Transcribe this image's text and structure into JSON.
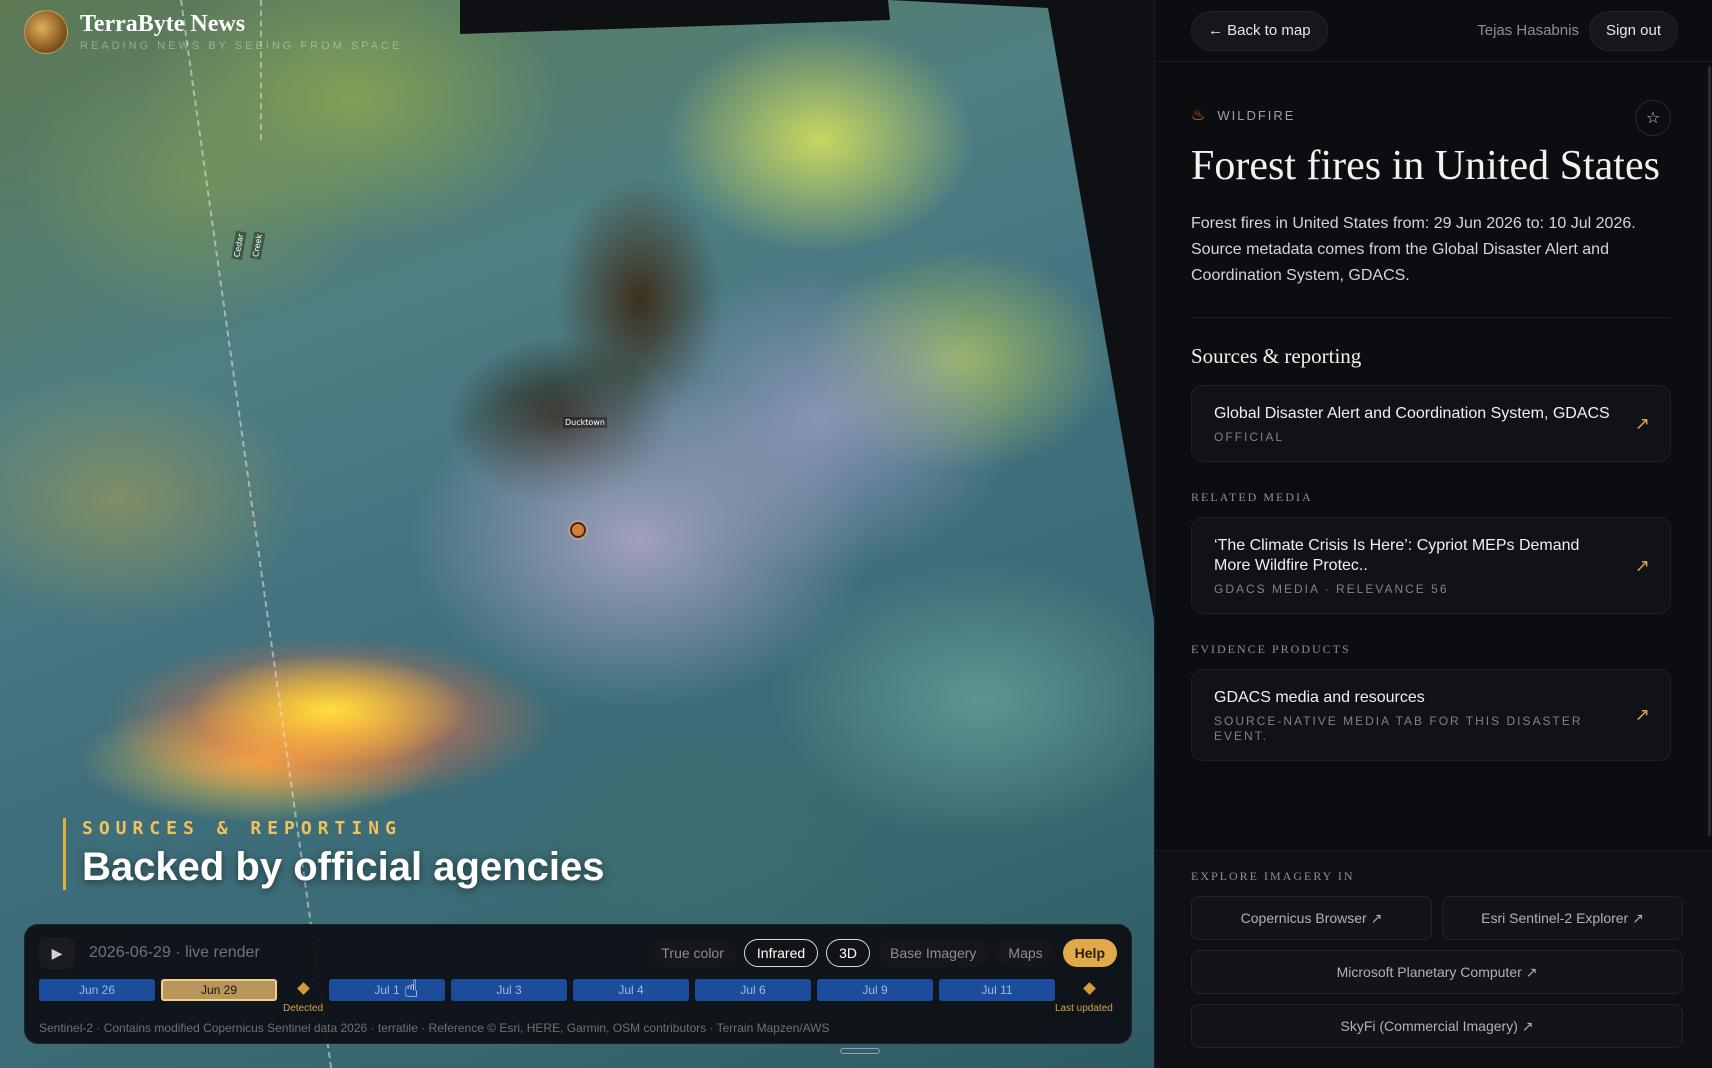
{
  "brand": {
    "name": "TerraByte News",
    "tagline": "READING NEWS BY SEEING FROM SPACE"
  },
  "map": {
    "labels": [
      "Cedar",
      "Creek",
      "Ducktown"
    ],
    "story": {
      "kicker": "SOURCES & REPORTING",
      "headline": "Backed by official agencies"
    }
  },
  "controls": {
    "play_icon": "▶",
    "date_readout": "2026-06-29 · live render",
    "toggles": [
      {
        "label": "True color",
        "active": false
      },
      {
        "label": "Infrared",
        "active": true
      },
      {
        "label": "3D",
        "active": true
      },
      {
        "label": "Base Imagery",
        "active": false
      },
      {
        "label": "Maps",
        "active": false
      },
      {
        "label": "Help",
        "active": false
      }
    ],
    "timeline": {
      "dates": [
        "Jun 26",
        "Jun 29",
        "Jul 1",
        "Jul 3",
        "Jul 4",
        "Jul 6",
        "Jul 9",
        "Jul 11"
      ],
      "selected": "Jun 29",
      "detected_label": "Detected",
      "last_updated_label": "Last updated"
    },
    "attribution": "Sentinel-2 · Contains modified Copernicus Sentinel data 2026 · terratile · Reference © Esri, HERE, Garmin, OSM contributors · Terrain Mapzen/AWS"
  },
  "sidebar": {
    "back_label": "← Back to map",
    "user_name": "Tejas Hasabnis",
    "signout_label": "Sign out",
    "category": "WILDFIRE",
    "title": "Forest fires in United States",
    "description": "Forest fires in United States from: 29 Jun 2026 to: 10 Jul 2026. Source metadata comes from the Global Disaster Alert and Coordination System, GDACS.",
    "sources_heading": "Sources & reporting",
    "source": {
      "title": "Global Disaster Alert and Coordination System, GDACS",
      "sub": "OFFICIAL"
    },
    "related_label": "RELATED MEDIA",
    "related": {
      "title": "‘The Climate Crisis Is Here’: Cypriot MEPs Demand More Wildfire Protec..",
      "sub": "GDACS MEDIA · RELEVANCE 56"
    },
    "evidence_label": "EVIDENCE PRODUCTS",
    "evidence": {
      "title": "GDACS media and resources",
      "sub": "SOURCE-NATIVE MEDIA TAB FOR THIS DISASTER EVENT."
    },
    "explore_label": "EXPLORE IMAGERY IN",
    "explore": [
      "Copernicus Browser ↗",
      "Esri Sentinel-2 Explorer ↗",
      "Microsoft Planetary Computer ↗",
      "SkyFi (Commercial Imagery) ↗"
    ],
    "icons": {
      "category": "fire-icon",
      "favorite": "star-icon",
      "external": "arrow-up-right-icon"
    },
    "colors": {
      "accent": "#e2a94a",
      "timeline_tick": "#1c4c9c"
    }
  }
}
